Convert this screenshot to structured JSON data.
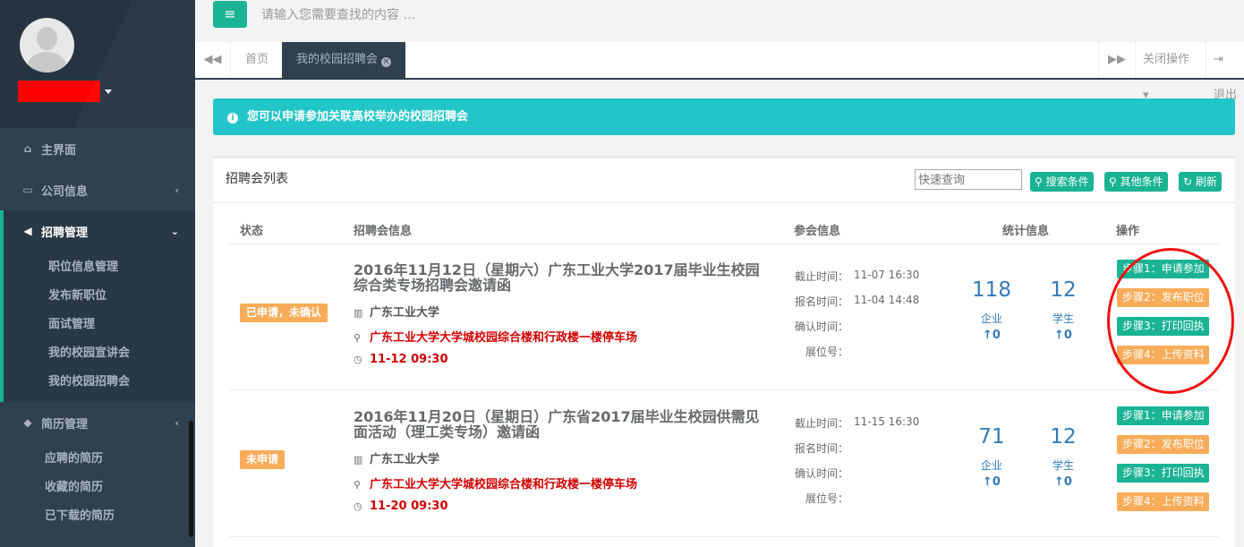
{
  "sidebar": {
    "items": [
      {
        "label": "主界面",
        "icon": "home-icon"
      },
      {
        "label": "公司信息",
        "icon": "desktop-icon"
      },
      {
        "label": "招聘管理",
        "icon": "bullhorn-icon"
      },
      {
        "label": "简历管理",
        "icon": "tags-icon"
      }
    ],
    "recruit_sub": [
      "职位信息管理",
      "发布新职位",
      "面试管理",
      "我的校园宣讲会",
      "我的校园招聘会"
    ],
    "resume_sub": [
      "应聘的简历",
      "收藏的简历",
      "已下载的简历"
    ]
  },
  "topbar": {
    "search_placeholder": "请输入您需要查找的内容 …",
    "menu_icon": "≡"
  },
  "tabs": {
    "home": "首页",
    "active": "我的校园招聘会",
    "close_ops": "关闭操作",
    "logout": "退出"
  },
  "alert": {
    "text": "您可以申请参加关联高校举办的校园招聘会"
  },
  "panel": {
    "title": "招聘会列表",
    "quick_placeholder": "快速查询",
    "buttons": {
      "search": "搜索条件",
      "other": "其他条件",
      "refresh": "刷新"
    }
  },
  "table": {
    "headers": {
      "status": "状态",
      "fair": "招聘会信息",
      "attend": "参会信息",
      "stats": "统计信息",
      "ops": "操作"
    },
    "labels": {
      "deadline": "截止时间：",
      "signup": "报名时间：",
      "confirm": "确认时间：",
      "booth": "展位号：",
      "company": "企业",
      "student": "学生"
    },
    "rows": [
      {
        "status": "已申请，未确认",
        "title": "2016年11月12日（星期六）广东工业大学2017届毕业生校园综合类专场招聘会邀请函",
        "school": "广东工业大学",
        "location": "广东工业大学大学城校园综合楼和行政楼一楼停车场",
        "time": "11-12 09:30",
        "deadline": "11-07 16:30",
        "signup": "11-04 14:48",
        "confirm": "",
        "booth": "",
        "companies": "118",
        "students": "12",
        "companies_up": "0",
        "students_up": "0",
        "steps": [
          "步骤1：申请参加",
          "步骤2：发布职位",
          "步骤3：打印回执",
          "步骤4：上传资料"
        ]
      },
      {
        "status": "未申请",
        "title": "2016年11月20日（星期日）广东省2017届毕业生校园供需见面活动（理工类专场）邀请函",
        "school": "广东工业大学",
        "location": "广东工业大学大学城校园综合楼和行政楼一楼停车场",
        "time": "11-20 09:30",
        "deadline": "11-15 16:30",
        "signup": "",
        "confirm": "",
        "booth": "",
        "companies": "71",
        "students": "12",
        "companies_up": "0",
        "students_up": "0",
        "steps": [
          "步骤1：申请参加",
          "步骤2：发布职位",
          "步骤3：打印回执",
          "步骤4：上传资料"
        ]
      }
    ]
  },
  "colors": {
    "accent": "#1ab394",
    "warning": "#f8ac59",
    "info": "#23c6c8",
    "sidebar": "#2f4050",
    "highlight_circle": "#ee1111"
  }
}
